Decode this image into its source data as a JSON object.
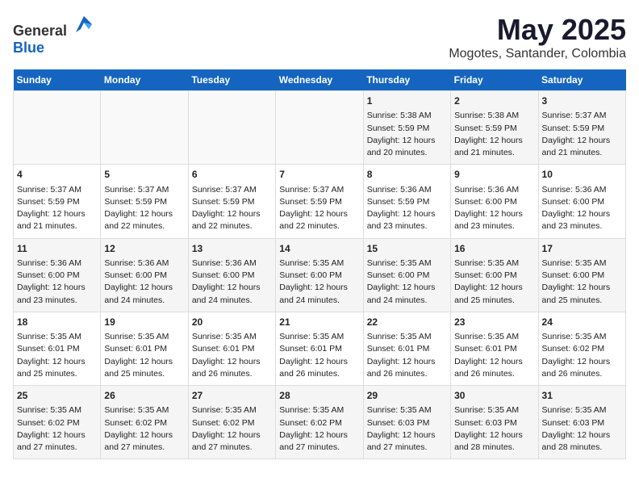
{
  "header": {
    "logo_general": "General",
    "logo_blue": "Blue",
    "month_title": "May 2025",
    "location": "Mogotes, Santander, Colombia"
  },
  "days_of_week": [
    "Sunday",
    "Monday",
    "Tuesday",
    "Wednesday",
    "Thursday",
    "Friday",
    "Saturday"
  ],
  "weeks": [
    [
      {
        "day": "",
        "content": ""
      },
      {
        "day": "",
        "content": ""
      },
      {
        "day": "",
        "content": ""
      },
      {
        "day": "",
        "content": ""
      },
      {
        "day": "1",
        "content": "Sunrise: 5:38 AM\nSunset: 5:59 PM\nDaylight: 12 hours\nand 20 minutes."
      },
      {
        "day": "2",
        "content": "Sunrise: 5:38 AM\nSunset: 5:59 PM\nDaylight: 12 hours\nand 21 minutes."
      },
      {
        "day": "3",
        "content": "Sunrise: 5:37 AM\nSunset: 5:59 PM\nDaylight: 12 hours\nand 21 minutes."
      }
    ],
    [
      {
        "day": "4",
        "content": "Sunrise: 5:37 AM\nSunset: 5:59 PM\nDaylight: 12 hours\nand 21 minutes."
      },
      {
        "day": "5",
        "content": "Sunrise: 5:37 AM\nSunset: 5:59 PM\nDaylight: 12 hours\nand 22 minutes."
      },
      {
        "day": "6",
        "content": "Sunrise: 5:37 AM\nSunset: 5:59 PM\nDaylight: 12 hours\nand 22 minutes."
      },
      {
        "day": "7",
        "content": "Sunrise: 5:37 AM\nSunset: 5:59 PM\nDaylight: 12 hours\nand 22 minutes."
      },
      {
        "day": "8",
        "content": "Sunrise: 5:36 AM\nSunset: 5:59 PM\nDaylight: 12 hours\nand 23 minutes."
      },
      {
        "day": "9",
        "content": "Sunrise: 5:36 AM\nSunset: 6:00 PM\nDaylight: 12 hours\nand 23 minutes."
      },
      {
        "day": "10",
        "content": "Sunrise: 5:36 AM\nSunset: 6:00 PM\nDaylight: 12 hours\nand 23 minutes."
      }
    ],
    [
      {
        "day": "11",
        "content": "Sunrise: 5:36 AM\nSunset: 6:00 PM\nDaylight: 12 hours\nand 23 minutes."
      },
      {
        "day": "12",
        "content": "Sunrise: 5:36 AM\nSunset: 6:00 PM\nDaylight: 12 hours\nand 24 minutes."
      },
      {
        "day": "13",
        "content": "Sunrise: 5:36 AM\nSunset: 6:00 PM\nDaylight: 12 hours\nand 24 minutes."
      },
      {
        "day": "14",
        "content": "Sunrise: 5:35 AM\nSunset: 6:00 PM\nDaylight: 12 hours\nand 24 minutes."
      },
      {
        "day": "15",
        "content": "Sunrise: 5:35 AM\nSunset: 6:00 PM\nDaylight: 12 hours\nand 24 minutes."
      },
      {
        "day": "16",
        "content": "Sunrise: 5:35 AM\nSunset: 6:00 PM\nDaylight: 12 hours\nand 25 minutes."
      },
      {
        "day": "17",
        "content": "Sunrise: 5:35 AM\nSunset: 6:00 PM\nDaylight: 12 hours\nand 25 minutes."
      }
    ],
    [
      {
        "day": "18",
        "content": "Sunrise: 5:35 AM\nSunset: 6:01 PM\nDaylight: 12 hours\nand 25 minutes."
      },
      {
        "day": "19",
        "content": "Sunrise: 5:35 AM\nSunset: 6:01 PM\nDaylight: 12 hours\nand 25 minutes."
      },
      {
        "day": "20",
        "content": "Sunrise: 5:35 AM\nSunset: 6:01 PM\nDaylight: 12 hours\nand 26 minutes."
      },
      {
        "day": "21",
        "content": "Sunrise: 5:35 AM\nSunset: 6:01 PM\nDaylight: 12 hours\nand 26 minutes."
      },
      {
        "day": "22",
        "content": "Sunrise: 5:35 AM\nSunset: 6:01 PM\nDaylight: 12 hours\nand 26 minutes."
      },
      {
        "day": "23",
        "content": "Sunrise: 5:35 AM\nSunset: 6:01 PM\nDaylight: 12 hours\nand 26 minutes."
      },
      {
        "day": "24",
        "content": "Sunrise: 5:35 AM\nSunset: 6:02 PM\nDaylight: 12 hours\nand 26 minutes."
      }
    ],
    [
      {
        "day": "25",
        "content": "Sunrise: 5:35 AM\nSunset: 6:02 PM\nDaylight: 12 hours\nand 27 minutes."
      },
      {
        "day": "26",
        "content": "Sunrise: 5:35 AM\nSunset: 6:02 PM\nDaylight: 12 hours\nand 27 minutes."
      },
      {
        "day": "27",
        "content": "Sunrise: 5:35 AM\nSunset: 6:02 PM\nDaylight: 12 hours\nand 27 minutes."
      },
      {
        "day": "28",
        "content": "Sunrise: 5:35 AM\nSunset: 6:02 PM\nDaylight: 12 hours\nand 27 minutes."
      },
      {
        "day": "29",
        "content": "Sunrise: 5:35 AM\nSunset: 6:03 PM\nDaylight: 12 hours\nand 27 minutes."
      },
      {
        "day": "30",
        "content": "Sunrise: 5:35 AM\nSunset: 6:03 PM\nDaylight: 12 hours\nand 28 minutes."
      },
      {
        "day": "31",
        "content": "Sunrise: 5:35 AM\nSunset: 6:03 PM\nDaylight: 12 hours\nand 28 minutes."
      }
    ]
  ]
}
